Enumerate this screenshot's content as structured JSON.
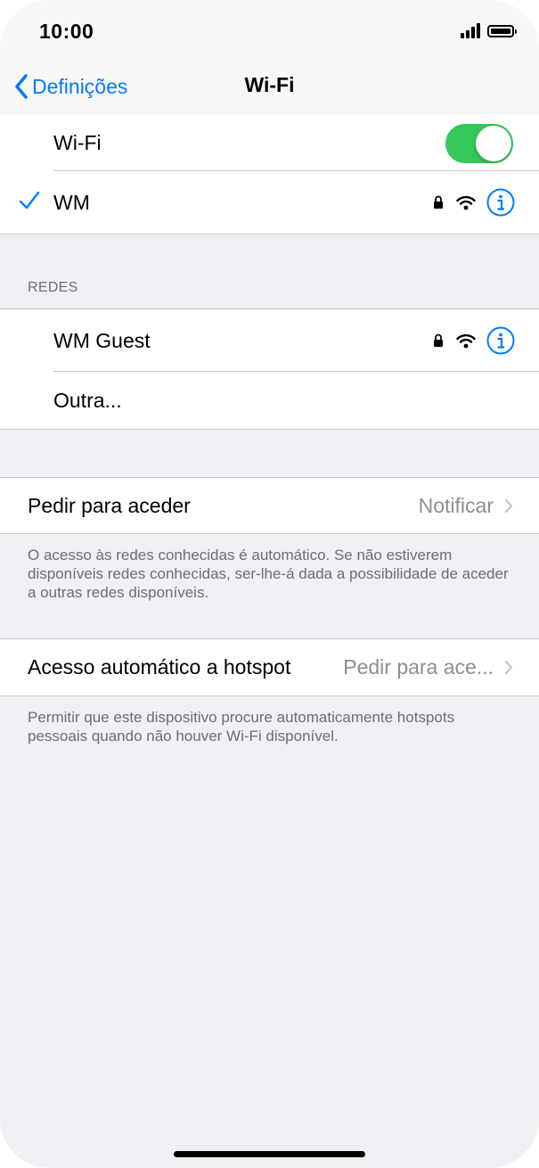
{
  "status_bar": {
    "time": "10:00"
  },
  "nav": {
    "back_label": "Definições",
    "title": "Wi-Fi"
  },
  "wifi_toggle": {
    "label": "Wi-Fi",
    "on": true
  },
  "connected_network": {
    "name": "WM"
  },
  "networks_section": {
    "header": "REDES",
    "items": [
      {
        "name": "WM Guest"
      },
      {
        "name": "Outra..."
      }
    ]
  },
  "ask_to_join": {
    "label": "Pedir para aceder",
    "value": "Notificar",
    "description": "O acesso às redes conhecidas é automático. Se não estiverem disponíveis redes conhecidas, ser-lhe-á dada a possibilidade de aceder a outras redes disponíveis."
  },
  "auto_hotspot": {
    "label": "Acesso automático a hotspot",
    "value": "Pedir para ace...",
    "description": "Permitir que este dispositivo procure automaticamente hotspots pessoais quando não houver Wi-Fi disponível."
  },
  "colors": {
    "accent": "#007aff",
    "toggle_on": "#34c759",
    "background": "#efeff4",
    "secondary_text": "#8e8e93"
  }
}
